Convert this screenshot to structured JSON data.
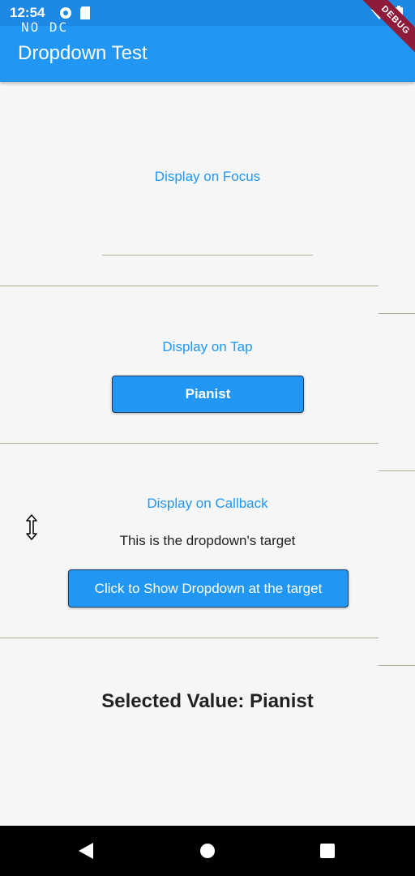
{
  "status_bar": {
    "time": "12:54",
    "overlay_text": "NO DC"
  },
  "app_bar": {
    "title": "Dropdown Test",
    "debug_badge": "DEBUG"
  },
  "sections": {
    "focus": {
      "title": "Display on Focus"
    },
    "tap": {
      "title": "Display on Tap",
      "button_label": "Pianist"
    },
    "callback": {
      "title": "Display on Callback",
      "target_text": "This is the dropdown's target",
      "button_label": "Click to Show Dropdown at the target"
    }
  },
  "selected_value": "Selected Value: Pianist",
  "icons": {
    "status": [
      "gear-icon",
      "sd-card-icon",
      "wifi-icon",
      "battery-icon"
    ],
    "cursor": "resize-vertical-cursor-icon",
    "nav": [
      "back-icon",
      "home-icon",
      "recents-icon"
    ]
  },
  "colors": {
    "primary": "#2196f3",
    "debug_banner": "#8e1b3a"
  }
}
